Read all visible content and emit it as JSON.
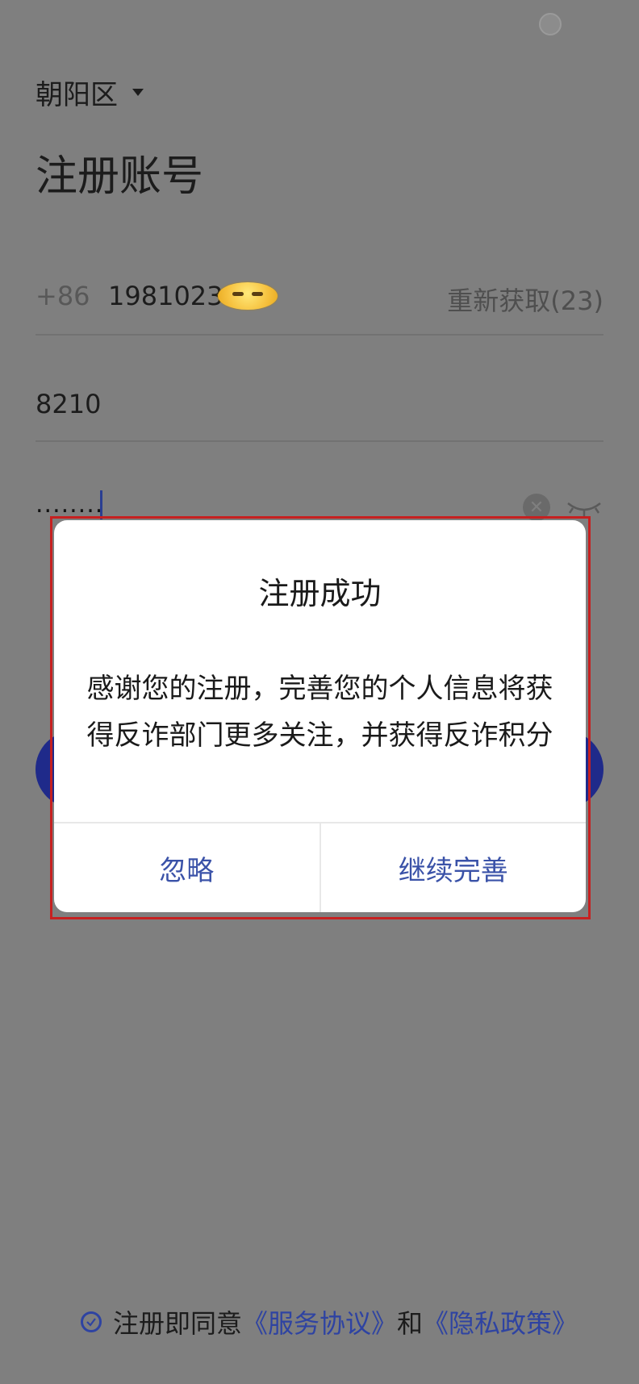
{
  "header": {
    "location": "朝阳区",
    "title": "注册账号"
  },
  "form": {
    "country_code": "+86",
    "phone_value": "1981023",
    "resend_label": "重新获取(23)",
    "code_value": "8210",
    "password_mask": "........"
  },
  "dialog": {
    "title": "注册成功",
    "message": "感谢您的注册，完善您的个人信息将获得反诈部门更多关注，并获得反诈积分",
    "ignore_label": "忽略",
    "continue_label": "继续完善"
  },
  "footer": {
    "agree_text": "注册即同意",
    "service_link": "《服务协议》",
    "and_text": "和",
    "privacy_link": "《隐私政策》"
  },
  "colors": {
    "accent": "#3a52a8",
    "overlay": "#7f7f7f",
    "highlight": "#c62020"
  }
}
